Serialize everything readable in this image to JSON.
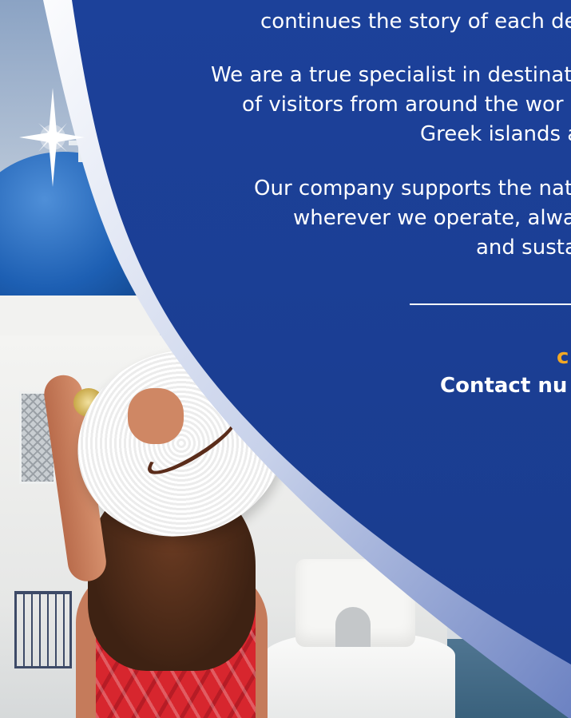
{
  "content": {
    "paragraph_1": {
      "line_1": "continues the story of each de"
    },
    "paragraph_2": {
      "line_1": "We are a true specialist in destinat",
      "line_2": "of visitors from around the wor",
      "line_3": "Greek islands a"
    },
    "paragraph_3": {
      "line_1": "Our company supports the nat",
      "line_2": "wherever we operate, alwa",
      "line_3": "and susta"
    },
    "accent_fragment": "c",
    "contact_label": "Contact nu"
  },
  "colors": {
    "panel_blue": "#1a3f94",
    "panel_edge_highlight": "#d8def0",
    "text": "#ffffff",
    "accent": "#f3a824"
  },
  "icons": {
    "sparkle": "four-point-star-sparkle"
  }
}
